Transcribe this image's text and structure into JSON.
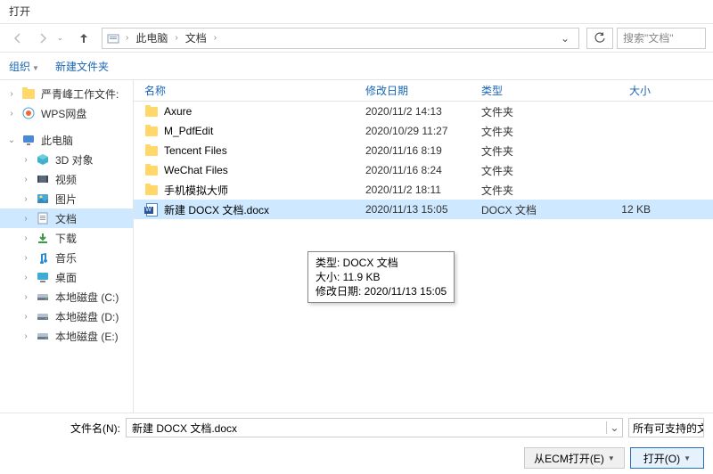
{
  "window": {
    "title": "打开"
  },
  "nav": {
    "crumbs": [
      "此电脑",
      "文档"
    ]
  },
  "search": {
    "placeholder": "搜索\"文档\""
  },
  "toolbar": {
    "organize": "组织",
    "newfolder": "新建文件夹"
  },
  "sidebar": [
    {
      "label": "严青峰工作文件:",
      "icon": "folder",
      "exp": "›",
      "indent": false
    },
    {
      "label": "WPS网盘",
      "icon": "wps",
      "exp": "›",
      "indent": false
    },
    {
      "label": "此电脑",
      "icon": "pc",
      "exp": "⌄",
      "indent": false
    },
    {
      "label": "3D 对象",
      "icon": "3d",
      "exp": "›",
      "indent": true
    },
    {
      "label": "视频",
      "icon": "video",
      "exp": "›",
      "indent": true
    },
    {
      "label": "图片",
      "icon": "pic",
      "exp": "›",
      "indent": true
    },
    {
      "label": "文档",
      "icon": "doc",
      "exp": "›",
      "indent": true,
      "selected": true
    },
    {
      "label": "下载",
      "icon": "dl",
      "exp": "›",
      "indent": true
    },
    {
      "label": "音乐",
      "icon": "music",
      "exp": "›",
      "indent": true
    },
    {
      "label": "桌面",
      "icon": "desk",
      "exp": "›",
      "indent": true
    },
    {
      "label": "本地磁盘 (C:)",
      "icon": "disk",
      "exp": "›",
      "indent": true
    },
    {
      "label": "本地磁盘 (D:)",
      "icon": "disk",
      "exp": "›",
      "indent": true
    },
    {
      "label": "本地磁盘 (E:)",
      "icon": "disk",
      "exp": "›",
      "indent": true
    }
  ],
  "columns": {
    "name": "名称",
    "date": "修改日期",
    "type": "类型",
    "size": "大小"
  },
  "files": [
    {
      "name": "Axure",
      "date": "2020/11/2 14:13",
      "type": "文件夹",
      "size": "",
      "icon": "folder"
    },
    {
      "name": "M_PdfEdit",
      "date": "2020/10/29 11:27",
      "type": "文件夹",
      "size": "",
      "icon": "folder"
    },
    {
      "name": "Tencent Files",
      "date": "2020/11/16 8:19",
      "type": "文件夹",
      "size": "",
      "icon": "folder"
    },
    {
      "name": "WeChat Files",
      "date": "2020/11/16 8:24",
      "type": "文件夹",
      "size": "",
      "icon": "folder"
    },
    {
      "name": "手机模拟大师",
      "date": "2020/11/2 18:11",
      "type": "文件夹",
      "size": "",
      "icon": "folder"
    },
    {
      "name": "新建 DOCX 文档.docx",
      "date": "2020/11/13 15:05",
      "type": "DOCX 文档",
      "size": "12 KB",
      "icon": "docx",
      "selected": true
    }
  ],
  "tooltip": {
    "l1": "类型: DOCX 文档",
    "l2": "大小: 11.9 KB",
    "l3": "修改日期: 2020/11/13 15:05"
  },
  "footer": {
    "filename_label": "文件名(N):",
    "filename_value": "新建 DOCX 文档.docx",
    "filter": "所有可支持的文",
    "ecm_open": "从ECM打开(E)",
    "open": "打开(O)"
  }
}
